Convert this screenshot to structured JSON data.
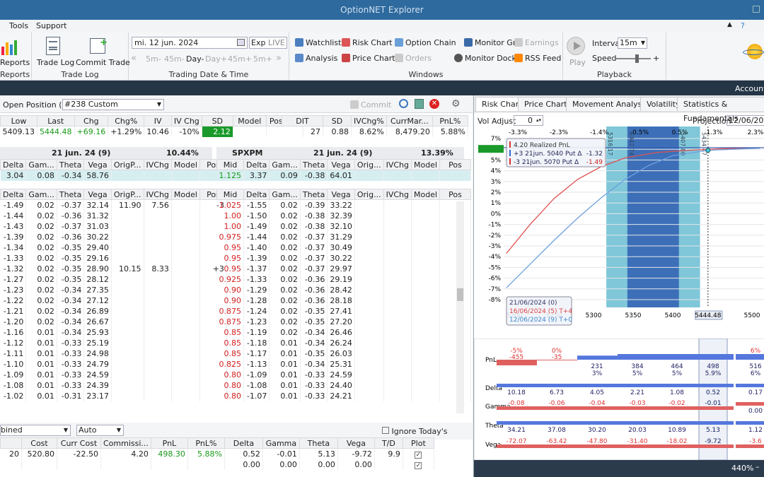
{
  "app": {
    "title": "OptionNET Explorer"
  },
  "menu": {
    "tools": "Tools",
    "support": "Support"
  },
  "ribbon": {
    "reports_group": "Reports",
    "reports_btn": "Reports",
    "tradelog_group": "Trade Log",
    "trade_log": "Trade Log",
    "commit_trade": "Commit Trade",
    "date_group": "Trading Date & Time",
    "date_value": "mi. 12 jun. 2024",
    "exp": "Exp",
    "live": "LIVE",
    "steps": [
      "5m-",
      "45m-",
      "Day-",
      "Day+",
      "45m+",
      "5m+"
    ],
    "windows_group": "Windows",
    "watchlist": "Watchlist",
    "risk_chart": "Risk Chart",
    "option_chain": "Option Chain",
    "monitor_grid": "Monitor Grid",
    "earnings": "Earnings",
    "analysis": "Analysis",
    "price_chart": "Price Chart",
    "orders": "Orders",
    "monitor_dock": "Monitor Dock",
    "rss_feed": "RSS Feed",
    "playback_group": "Playback",
    "play": "Play",
    "interval_label": "Interval",
    "interval_value": "15m",
    "speed_label": "Speed"
  },
  "account": {
    "label": "Account:"
  },
  "position": {
    "open_label": "Open Position (1)",
    "name": "#238 Custom",
    "commit": "Commit"
  },
  "summary1": {
    "headers": [
      "Low",
      "Last",
      "Chg",
      "Chg%",
      "IV",
      "IV Chg",
      "SD",
      "Model",
      "Position"
    ],
    "values": [
      "5409.13",
      "5444.48",
      "+69.16",
      "+1.29%",
      "10.46",
      "-10%",
      "2.12",
      "",
      ""
    ]
  },
  "summary2": {
    "headers": [
      "DIT",
      "SD",
      "IVChg%",
      "CurrMar...",
      "PnL%"
    ],
    "values": [
      "27",
      "0.88",
      "8.62%",
      "8,479.20",
      "5.88%"
    ]
  },
  "chainL": {
    "exp": "21 jun. 24 (9)",
    "pct": "10.44%",
    "headers": [
      "Delta",
      "Gam...",
      "Theta",
      "Vega",
      "OrigP...",
      "IVChg",
      "Model",
      "Pos"
    ],
    "sel": [
      "3.04",
      "0.08",
      "-0.34",
      "58.76",
      "",
      "",
      "",
      ""
    ]
  },
  "chainR": {
    "sym": "SPXPM",
    "exp": "21 jun. 24 (9)",
    "pct": "13.39%",
    "headers": [
      "Mid",
      "Delta",
      "Gam...",
      "Theta",
      "Vega",
      "Orig...",
      "IVChg",
      "Model",
      "Pos"
    ],
    "sel": [
      "1.125",
      "3.37",
      "0.09",
      "-0.38",
      "64.01",
      "",
      "",
      "",
      ""
    ]
  },
  "gridL": {
    "headers": [
      "Delta",
      "Gam...",
      "Theta",
      "Vega",
      "OrigP...",
      "IVChg",
      "Model",
      "Pos"
    ],
    "rows": [
      [
        "-1.49",
        "0.02",
        "-0.37",
        "32.14",
        "11.90",
        "7.56",
        "",
        "-3"
      ],
      [
        "-1.44",
        "0.02",
        "-0.36",
        "31.32",
        "",
        "",
        "",
        ""
      ],
      [
        "-1.43",
        "0.02",
        "-0.37",
        "31.03",
        "",
        "",
        "",
        ""
      ],
      [
        "-1.39",
        "0.02",
        "-0.36",
        "30.22",
        "",
        "",
        "",
        ""
      ],
      [
        "-1.34",
        "0.02",
        "-0.35",
        "29.40",
        "",
        "",
        "",
        ""
      ],
      [
        "-1.33",
        "0.02",
        "-0.35",
        "29.16",
        "",
        "",
        "",
        ""
      ],
      [
        "-1.32",
        "0.02",
        "-0.35",
        "28.90",
        "10.15",
        "8.33",
        "",
        "+3"
      ],
      [
        "-1.27",
        "0.02",
        "-0.35",
        "28.12",
        "",
        "",
        "",
        ""
      ],
      [
        "-1.23",
        "0.02",
        "-0.34",
        "27.35",
        "",
        "",
        "",
        ""
      ],
      [
        "-1.22",
        "0.02",
        "-0.34",
        "27.12",
        "",
        "",
        "",
        ""
      ],
      [
        "-1.21",
        "0.02",
        "-0.34",
        "26.89",
        "",
        "",
        "",
        ""
      ],
      [
        "-1.20",
        "0.02",
        "-0.34",
        "26.67",
        "",
        "",
        "",
        ""
      ],
      [
        "-1.16",
        "0.01",
        "-0.34",
        "25.93",
        "",
        "",
        "",
        ""
      ],
      [
        "-1.12",
        "0.01",
        "-0.33",
        "25.19",
        "",
        "",
        "",
        ""
      ],
      [
        "-1.11",
        "0.01",
        "-0.33",
        "24.98",
        "",
        "",
        "",
        ""
      ],
      [
        "-1.10",
        "0.01",
        "-0.33",
        "24.79",
        "",
        "",
        "",
        ""
      ],
      [
        "-1.09",
        "0.01",
        "-0.33",
        "24.59",
        "",
        "",
        "",
        ""
      ],
      [
        "-1.08",
        "0.01",
        "-0.33",
        "24.39",
        "",
        "",
        "",
        ""
      ],
      [
        "-1.02",
        "0.01",
        "-0.31",
        "23.17",
        "",
        "",
        "",
        ""
      ]
    ]
  },
  "gridR": {
    "headers": [
      "Mid",
      "Delta",
      "Gam...",
      "Theta",
      "Vega",
      "Orig...",
      "IVChg",
      "Model",
      "Pos"
    ],
    "rows": [
      [
        "1.025",
        "-1.55",
        "0.02",
        "-0.39",
        "33.22"
      ],
      [
        "1.00",
        "-1.50",
        "0.02",
        "-0.38",
        "32.39"
      ],
      [
        "1.00",
        "-1.49",
        "0.02",
        "-0.38",
        "32.10"
      ],
      [
        "0.975",
        "-1.44",
        "0.02",
        "-0.37",
        "31.29"
      ],
      [
        "0.95",
        "-1.40",
        "0.02",
        "-0.37",
        "30.49"
      ],
      [
        "0.95",
        "-1.39",
        "0.02",
        "-0.37",
        "30.22"
      ],
      [
        "0.95",
        "-1.37",
        "0.02",
        "-0.37",
        "29.97"
      ],
      [
        "0.925",
        "-1.33",
        "0.02",
        "-0.36",
        "29.19"
      ],
      [
        "0.90",
        "-1.29",
        "0.02",
        "-0.36",
        "28.42"
      ],
      [
        "0.90",
        "-1.28",
        "0.02",
        "-0.36",
        "28.18"
      ],
      [
        "0.875",
        "-1.24",
        "0.02",
        "-0.35",
        "27.41"
      ],
      [
        "0.875",
        "-1.23",
        "0.02",
        "-0.35",
        "27.20"
      ],
      [
        "0.85",
        "-1.19",
        "0.02",
        "-0.34",
        "26.46"
      ],
      [
        "0.85",
        "-1.18",
        "0.01",
        "-0.34",
        "26.24"
      ],
      [
        "0.85",
        "-1.17",
        "0.01",
        "-0.35",
        "26.03"
      ],
      [
        "0.825",
        "-1.13",
        "0.01",
        "-0.34",
        "25.31"
      ],
      [
        "0.80",
        "-1.09",
        "0.01",
        "-0.33",
        "24.59"
      ],
      [
        "0.80",
        "-1.08",
        "0.01",
        "-0.33",
        "24.40"
      ],
      [
        "0.80",
        "-1.07",
        "0.01",
        "-0.33",
        "24.21"
      ]
    ]
  },
  "bottom": {
    "combined": "bined",
    "auto": "Auto",
    "ignore": "Ignore Today's Trades",
    "headers": [
      "Cost",
      "Curr Cost",
      "Commissi...",
      "PnL",
      "PnL%",
      "Delta",
      "Gamma",
      "Theta",
      "Vega",
      "T/D",
      "Plot"
    ],
    "row1": [
      "20",
      "520.80",
      "-22.50",
      "4.20",
      "498.30",
      "5.88%",
      "0.52",
      "-0.01",
      "5.13",
      "-9.72",
      "9.9"
    ],
    "row2": [
      "0.00",
      "0.00",
      "0.00",
      "0.00"
    ],
    "check": "✓"
  },
  "right": {
    "tabs": [
      "Risk Chart",
      "Price Chart",
      "Movement Analysis",
      "Volatility",
      "Statistics & Fundamentals"
    ],
    "vol_adjust": "Vol Adjust",
    "vol_value": "0",
    "projection_label": "Projection",
    "projection_value": "12/06/2024",
    "top_pcts": [
      "-3.3%",
      "-2.3%",
      "-1.4%",
      "-0.5%",
      "0.5%",
      "1.3%",
      "2.3%"
    ],
    "y_ticks": [
      "7%",
      "6%",
      "5%",
      "4%",
      "3%",
      "2%",
      "1%",
      "0%",
      "-1%",
      "-2%",
      "-3%",
      "-4%",
      "-5%",
      "-6%",
      "-7%",
      "-8%"
    ],
    "x_ticks": [
      "5200",
      "5250",
      "5300",
      "5350",
      "5400",
      "5500"
    ],
    "current": "5444.48",
    "band_labels": [
      "5316.17",
      "5342.74",
      "5407.80",
      "5434.47"
    ],
    "legend1": [
      "4.20 Realized PnL",
      "+3 21jun. 5040 Put Δ",
      "-3 21jun. 5070 Put Δ"
    ],
    "legend1_vals": [
      "-1.32",
      "-1.49"
    ],
    "legend2": [
      "21/06/2024 (0)",
      "16/06/2024 (5) T+4",
      "12/06/2024 (9) T+0"
    ],
    "colors": {
      "band": "#7fc7d9",
      "inner": "#3d6fb8",
      "red": "#e05050",
      "blue": "#6fa0e0"
    },
    "greeks": {
      "labels": [
        "PnL",
        "Delta",
        "Gamma",
        "Theta",
        "Vega"
      ],
      "pnl_top": [
        "-5%",
        "0%",
        "",
        "",
        "",
        "",
        "6%"
      ],
      "pnl_neg": [
        "-455",
        "-35"
      ],
      "pnl_pos": [
        "231",
        "384",
        "464",
        "498",
        "516"
      ],
      "pnl_pos_pct": [
        "3%",
        "5%",
        "5%",
        "5.9%",
        "6%"
      ],
      "delta": [
        "10.18",
        "6.73",
        "4.05",
        "2.21",
        "1.08",
        "0.52",
        "0.17"
      ],
      "gamma": [
        "-0.08",
        "-0.06",
        "-0.04",
        "-0.03",
        "-0.02",
        "-0.01",
        "0.00"
      ],
      "theta": [
        "34.21",
        "37.08",
        "30.20",
        "20.03",
        "10.89",
        "5.13",
        "1.12"
      ],
      "vega": [
        "-72.07",
        "-63.42",
        "-47.80",
        "-31.40",
        "-18.02",
        "-9.72",
        "-3.6"
      ]
    },
    "zoom": "440%"
  }
}
